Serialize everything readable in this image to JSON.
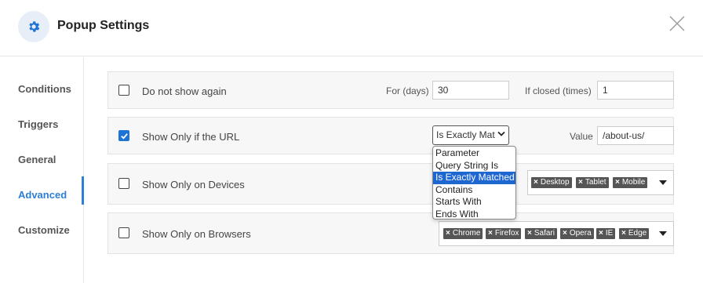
{
  "header": {
    "title": "Popup Settings"
  },
  "sidebar": {
    "items": [
      {
        "label": "Conditions"
      },
      {
        "label": "Triggers"
      },
      {
        "label": "General"
      },
      {
        "label": "Advanced",
        "active": true
      },
      {
        "label": "Customize"
      }
    ]
  },
  "rows": {
    "dont_show": {
      "label": "Do not show again",
      "checked": false,
      "days_label": "For (days)",
      "days_value": "30",
      "closed_label": "If closed (times)",
      "closed_value": "1"
    },
    "url": {
      "label": "Show Only if the URL",
      "checked": true,
      "match_selected": "Is Exactly Matched",
      "match_selected_visible": "Is Exactly Mat",
      "value_label": "Value",
      "value": "/about-us/"
    },
    "devices": {
      "label": "Show Only on Devices",
      "checked": false,
      "tags": [
        "Desktop",
        "Tablet",
        "Mobile"
      ]
    },
    "browsers": {
      "label": "Show Only on Browsers",
      "checked": false,
      "tags": [
        "Chrome",
        "Firefox",
        "Safari",
        "Opera",
        "IE",
        "Edge"
      ]
    }
  },
  "match_options": [
    "Parameter",
    "Query String Is",
    "Is Exactly Matched",
    "Contains",
    "Starts With",
    "Ends With"
  ],
  "colors": {
    "accent": "#2d7fd3",
    "checkbox_checked": "#1f73d6",
    "option_highlight": "#1e66d0",
    "tag_bg": "#555555"
  },
  "icons": {
    "header": "gear-icon",
    "close": "close-icon",
    "check": "check-icon",
    "caret": "caret-down-icon"
  }
}
